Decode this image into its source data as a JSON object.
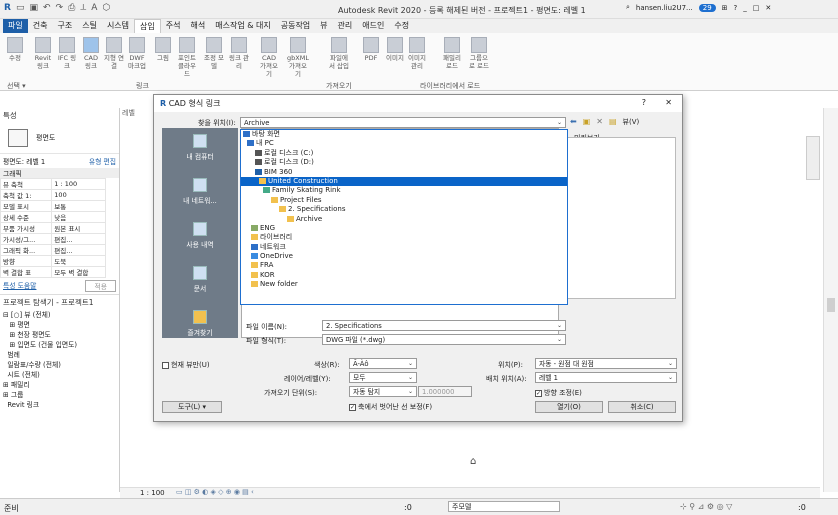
{
  "app": {
    "title": "Autodesk Revit 2020 - 등록 해제된 버전 - 프로젝트1 - 평면도: 레벨 1",
    "user": "hansen.liu2U7...",
    "badge": "29"
  },
  "ribbon_tabs": [
    "파일",
    "건축",
    "구조",
    "스틸",
    "시스템",
    "삽입",
    "주석",
    "해석",
    "매스작업 & 대지",
    "공동작업",
    "뷰",
    "관리",
    "애드인",
    "수정",
    ""
  ],
  "ribbon_buttons": [
    "수정",
    "Revit 링크",
    "IFC 링크",
    "CAD 링크",
    "지형 연결",
    "DWF 마크업",
    "그림",
    "포인트 클라우드",
    "조정 모델",
    "링크 관리",
    "CAD 가져오기",
    "gbXML 가져오기",
    "파일에서 삽입",
    "PDF",
    "이미지",
    "이미지 관리",
    "패밀리 로드",
    "그룹으로 로드"
  ],
  "ribbon_groups": {
    "select": "선택 ▾",
    "link": "링크",
    "import": "가져오기",
    "load": "라이브러리에서 로드"
  },
  "left_panel": {
    "props_header": "특성",
    "type": "평면도",
    "view_sel": "평면도: 레벨 1",
    "edit_type": "유형 편집",
    "graphics": "그래픽",
    "props": [
      [
        "뷰 축척",
        "1 : 100"
      ],
      [
        "축척 값   1:",
        "100"
      ],
      [
        "모델 표시",
        "보통"
      ],
      [
        "상세 수준",
        "낮음"
      ],
      [
        "부품 가시성",
        "원본 표시"
      ],
      [
        "가시성/그...",
        "편집..."
      ],
      [
        "그래픽 화...",
        "편집..."
      ],
      [
        "방향",
        "도북"
      ],
      [
        "벽 결합 표",
        "모두 벽 결합"
      ]
    ],
    "help": "특성 도움말",
    "apply": "적용",
    "browser_header": "프로젝트 탐색기 - 프로젝트1",
    "tree": [
      "⊟ [○] 뷰 (전체)",
      "   ⊞ 평면",
      "   ⊞ 천장 평면도",
      "   ⊞ 입면도 (건물 입면도)",
      "  범례",
      "  일람표/수량 (전체)",
      "  시트 (전체)",
      "⊞ 패밀리",
      "⊞ 그룹",
      "  Revit 링크"
    ]
  },
  "view": {
    "tab": "레벨",
    "scale": "1 : 100",
    "status_left": "준비",
    "status_mid": ":0",
    "status_model": "주모델",
    "filter_count": ":0"
  },
  "dialog": {
    "title": "CAD 형식 링크",
    "close": "✕",
    "help": "?",
    "look_in_label": "찾을 위치(I):",
    "look_in_value": "Archive",
    "views_label": "뷰(V)",
    "preview_label": "미리보기",
    "places": [
      "내 컴퓨터",
      "내 네트워...",
      "사용 내역",
      "문서",
      "즐겨찾기",
      ""
    ],
    "dropdown": [
      "바탕 화면",
      "내 PC",
      "로컬 디스크 (C:)",
      "로컬 디스크 (D:)",
      "BIM 360",
      "United Construction",
      "Family Skating Rink",
      "Project Files",
      "2. Specifications",
      "Archive",
      "ENG",
      "라이브러리",
      "네트워크",
      "OneDrive",
      "FRA",
      "KOR",
      "New folder"
    ],
    "file_name_label": "파일 이름(N):",
    "file_name_value": "2. Specifications",
    "file_type_label": "파일 형식(T):",
    "file_type_value": "DWG 파일 (*.dwg)",
    "current_view": "현재 뷰만(U)",
    "color_label": "색상(R):",
    "color_value": "Ã-Àô",
    "layers_label": "레이어/레벨(Y):",
    "layers_value": "모두",
    "units_label": "가져오기 단위(S):",
    "units_value": "자동 탐지",
    "units_factor": "1.000000",
    "lines_chk": "축에서 벗어난 선 보정(F)",
    "pos_label": "위치(P):",
    "pos_value": "자동 - 원점 대 원점",
    "place_label": "배치 위치(A):",
    "place_value": "레벨 1",
    "orient_chk": "방향 조정(E)",
    "tools": "도구(L)",
    "open": "열기(O)",
    "cancel": "취소(C)"
  }
}
